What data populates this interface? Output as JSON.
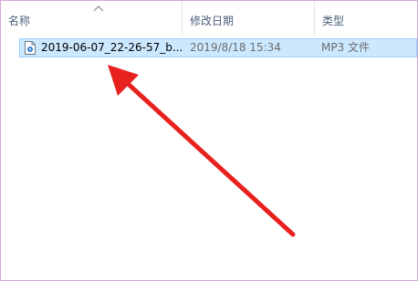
{
  "columns": {
    "name": "名称",
    "modified": "修改日期",
    "type": "类型"
  },
  "file": {
    "name": "2019-06-07_22-26-57_b...",
    "modified": "2019/8/18 15:34",
    "type": "MP3 文件"
  },
  "colors": {
    "selection_bg": "#cce8ff",
    "selection_border": "#99d1ff",
    "annotation_arrow": "#e8201e"
  },
  "icons": {
    "sort": "sort-ascending-icon",
    "file": "audio-file-icon",
    "annotation": "red-arrow"
  }
}
